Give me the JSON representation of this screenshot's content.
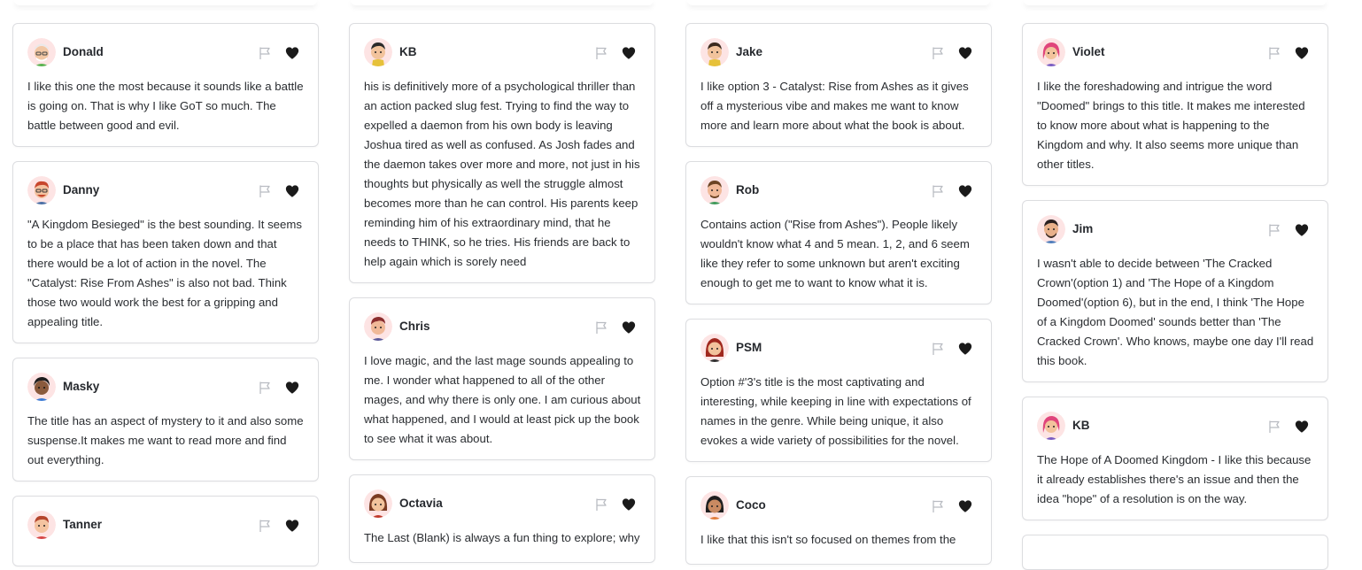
{
  "columns": [
    {
      "cards": [
        {
          "name": "Donald",
          "text": "I like this one the most because it sounds like a battle is going on. That is why I like GoT so much. The battle between good and evil."
        },
        {
          "name": "Danny",
          "text": "\"A Kingdom Besieged\" is the best sounding. It seems to be a place that has been taken down and that there would be a lot of action in the novel. The \"Catalyst: Rise From Ashes\" is also not bad. Think those two would work the best for a gripping and appealing title."
        },
        {
          "name": "Masky",
          "text": "The title has an aspect of mystery to it and also some suspense.It makes me want to read more and find out everything."
        },
        {
          "name": "Tanner",
          "text": ""
        }
      ]
    },
    {
      "cards": [
        {
          "name": "KB",
          "text": "his is definitively more of a psychological thriller than an action packed slug fest. Trying to find the way to expelled a daemon from his own body is leaving Joshua tired as well as confused. As Josh fades and the daemon takes over more and more, not just in his thoughts but physically as well the struggle almost becomes more than he can control. His parents keep reminding him of his extraordinary mind, that he needs to THINK, so he tries. His friends are back to help again which is sorely need"
        },
        {
          "name": "Chris",
          "text": "I love magic, and the last mage sounds appealing to me. I wonder what happened to all of the other mages, and why there is only one. I am curious about what happened, and I would at least pick up the book to see what it was about."
        },
        {
          "name": "Octavia",
          "text": "The Last (Blank) is always a fun thing to explore; why"
        }
      ]
    },
    {
      "cards": [
        {
          "name": "Jake",
          "text": "I like option 3 - Catalyst: Rise from Ashes as it gives off a mysterious vibe and makes me want to know more and learn more about what the book is about."
        },
        {
          "name": "Rob",
          "text": "Contains action (\"Rise from Ashes\"). People likely wouldn't know what 4 and 5 mean. 1, 2, and 6 seem like they refer to some unknown but aren't exciting enough to get me to want to know what it is."
        },
        {
          "name": "PSM",
          "text": "Option #'3's title is the most captivating and interesting, while keeping in line with expectations of names in the genre. While being unique, it also evokes a wide variety of possibilities for the novel."
        },
        {
          "name": "Coco",
          "text": "I like that this isn't so focused on themes from the"
        }
      ]
    },
    {
      "cards": [
        {
          "name": "Violet",
          "text": "I like the foreshadowing and intrigue the word \"Doomed\" brings to this title. It makes me interested to know more about what is happening to the Kingdom and why. It also seems more unique than other titles."
        },
        {
          "name": "Jim",
          "text": "I wasn't able to decide between 'The Cracked Crown'(option 1) and 'The Hope of a Kingdom Doomed'(option 6), but in the end, I think 'The Hope of a Kingdom Doomed' sounds better than 'The Cracked Crown'. Who knows, maybe one day I'll read this book."
        },
        {
          "name": "KB",
          "text": "The Hope of A Doomed Kingdom - I like this because it already establishes there's an issue and then the idea \"hope\" of a resolution is on the way."
        }
      ]
    }
  ],
  "icons": {
    "flag": "flag-icon",
    "heart": "heart-icon",
    "avatar": "avatar-icon"
  },
  "colors": {
    "border": "#dcdde0",
    "heart": "#1a1a1a",
    "flag": "#b9bcc2"
  }
}
